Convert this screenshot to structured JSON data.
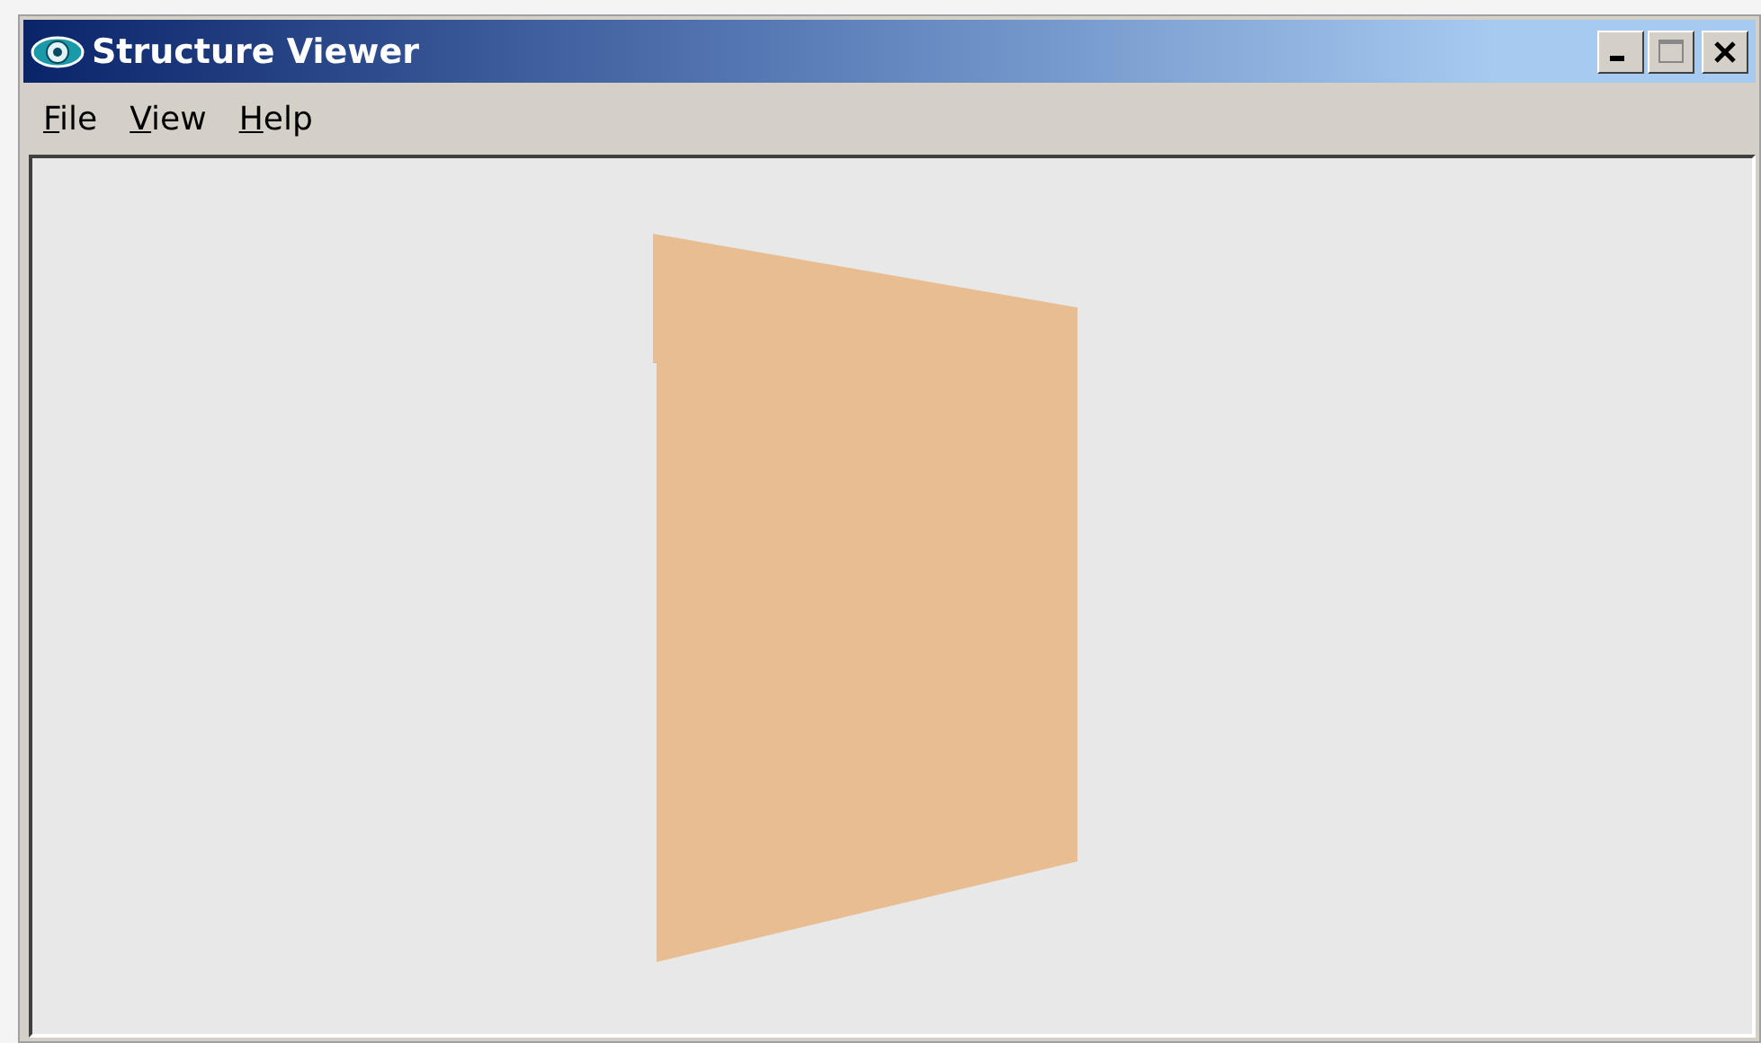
{
  "window": {
    "title": "Structure Viewer"
  },
  "menu": [
    {
      "label": "File"
    },
    {
      "label": "View"
    },
    {
      "label": "Help"
    }
  ]
}
